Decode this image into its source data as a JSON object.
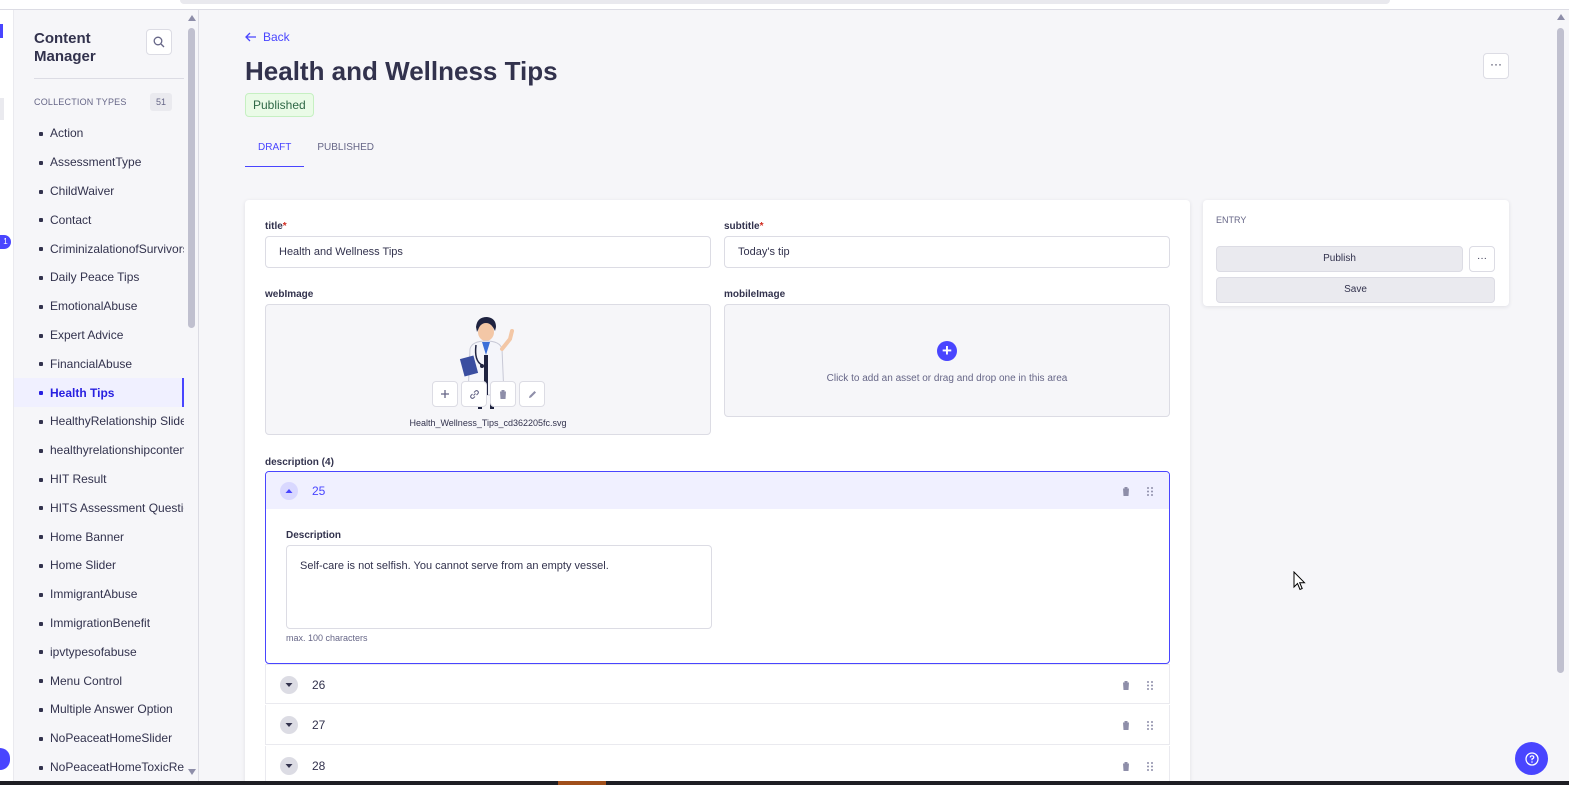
{
  "sidebar": {
    "title": "Content Manager",
    "section_label": "COLLECTION TYPES",
    "count": "51",
    "items": [
      "Action",
      "AssessmentType",
      "ChildWaiver",
      "Contact",
      "CriminizalationofSurvivors",
      "Daily Peace Tips",
      "EmotionalAbuse",
      "Expert Advice",
      "FinancialAbuse",
      "Health Tips",
      "HealthyRelationship Slider",
      "healthyrelationshipcontent",
      "HIT Result",
      "HITS Assessment Question",
      "Home Banner",
      "Home Slider",
      "ImmigrantAbuse",
      "ImmigrationBenefit",
      "ipvtypesofabuse",
      "Menu Control",
      "Multiple Answer Option",
      "NoPeaceatHomeSlider",
      "NoPeaceatHomeToxicRel..."
    ],
    "active_item": "Health Tips"
  },
  "nav": {
    "notification_count": "1"
  },
  "header": {
    "back_label": "Back",
    "title": "Health and Wellness Tips",
    "status_badge": "Published",
    "more_label": "···"
  },
  "tabs": [
    "DRAFT",
    "PUBLISHED"
  ],
  "active_tab": "DRAFT",
  "form": {
    "title_label": "title",
    "title_value": "Health and Wellness Tips",
    "subtitle_label": "subtitle",
    "subtitle_value": "Today's tip",
    "required_mark": "*",
    "webimage_label": "webImage",
    "webimage_filename": "Health_Wellness_Tips_cd362205fc.svg",
    "mobileimage_label": "mobileImage",
    "mobileimage_empty_text": "Click to add an asset or drag and drop one in this area",
    "description_label": "description (4)",
    "description_entries": [
      {
        "id": "25",
        "expanded": true,
        "field_label": "Description",
        "value": "Self-care is not selfish. You cannot serve from an empty vessel.",
        "hint": "max. 100 characters"
      },
      {
        "id": "26",
        "expanded": false
      },
      {
        "id": "27",
        "expanded": false
      },
      {
        "id": "28",
        "expanded": false
      }
    ]
  },
  "entry_panel": {
    "heading": "ENTRY",
    "publish_label": "Publish",
    "more_label": "···",
    "save_label": "Save"
  },
  "colors": {
    "accent": "#4945ff",
    "success_bg": "#eafbe7",
    "success_text": "#2f6846"
  }
}
